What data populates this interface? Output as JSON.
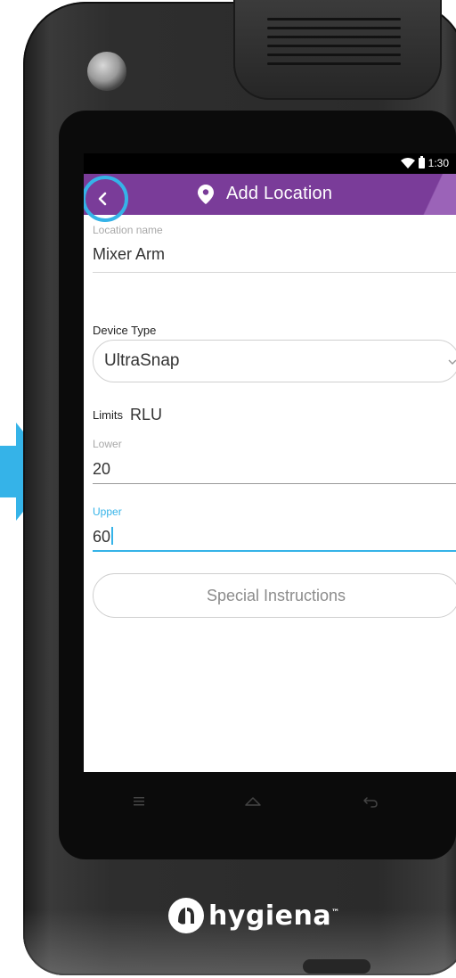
{
  "status_bar": {
    "time": "1:30"
  },
  "app_bar": {
    "title": "Add Location",
    "accent_color": "#7a3c99",
    "highlight_color": "#35b3e8"
  },
  "form": {
    "location_name": {
      "label": "Location name",
      "value": "Mixer Arm"
    },
    "device_type": {
      "label": "Device Type",
      "value": "UltraSnap"
    },
    "limits": {
      "label": "Limits",
      "unit": "RLU",
      "lower": {
        "label": "Lower",
        "value": "20"
      },
      "upper": {
        "label": "Upper",
        "value": "60"
      }
    },
    "special_instructions_label": "Special Instructions"
  },
  "brand": {
    "name": "hygiena",
    "tm": "™"
  },
  "icons": [
    "back-icon",
    "pin-icon",
    "wifi-icon",
    "battery-icon",
    "chevron-down-icon",
    "menu-icon",
    "home-icon",
    "back-nav-icon",
    "hygiena-logo-icon"
  ]
}
